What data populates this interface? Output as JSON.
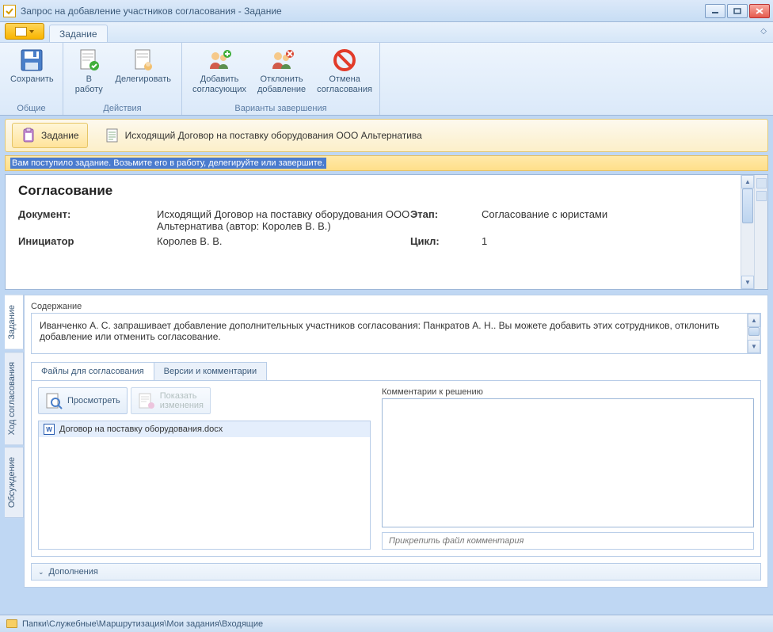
{
  "window": {
    "title": "Запрос на добавление участников согласования - Задание"
  },
  "ribbon": {
    "tab": "Задание",
    "groups": {
      "common": {
        "name": "Общие",
        "save": "Сохранить"
      },
      "actions": {
        "name": "Действия",
        "to_work": "В работу",
        "delegate": "Делегировать"
      },
      "variants": {
        "name": "Варианты завершения",
        "add": "Добавить\nсогласующих",
        "reject": "Отклонить\nдобавление",
        "cancel": "Отмена\nсогласования"
      }
    }
  },
  "viewbar": {
    "task": "Задание",
    "doc": "Исходящий Договор на поставку оборудования ООО Альтернатива"
  },
  "infoband": "Вам поступило задание. Возьмите его в работу, делегируйте или завершите.",
  "detail": {
    "heading": "Согласование",
    "doc_label": "Документ:",
    "doc_value": "Исходящий Договор на поставку оборудования ООО Альтернатива (автор: Королев В. В.)",
    "stage_label": "Этап:",
    "stage_value": "Согласование с юристами",
    "initiator_label": "Инициатор",
    "initiator_value": "Королев В. В.",
    "cycle_label": "Цикл:",
    "cycle_value": "1"
  },
  "sidetabs": {
    "task": "Задание",
    "progress": "Ход согласования",
    "discussion": "Обсуждение"
  },
  "content": {
    "label": "Содержание",
    "text": "Иванченко А. С. запрашивает добавление дополнительных участников согласования: Панкратов А. Н.. Вы можете добавить этих сотрудников, отклонить добавление или отменить согласование."
  },
  "innerTabs": {
    "files": "Файлы для согласования",
    "versions": "Версии и комментарии"
  },
  "filesPanel": {
    "view": "Просмотреть",
    "showChanges": "Показать\nизменения",
    "file": "Договор на поставку оборудования.docx"
  },
  "commentsPanel": {
    "label": "Комментарии к решению",
    "attach": "Прикрепить файл комментария"
  },
  "expander": "Дополнения",
  "status": {
    "path": "Папки\\Служебные\\Маршрутизация\\Мои задания\\Входящие"
  }
}
